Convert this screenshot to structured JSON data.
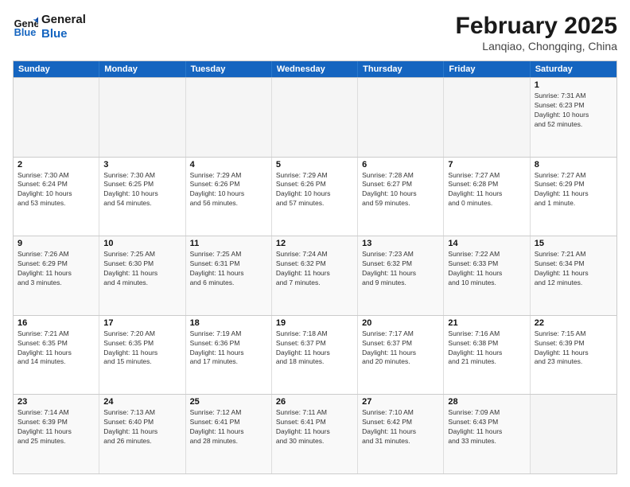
{
  "logo": {
    "line1": "General",
    "line2": "Blue"
  },
  "title": "February 2025",
  "subtitle": "Lanqiao, Chongqing, China",
  "header_days": [
    "Sunday",
    "Monday",
    "Tuesday",
    "Wednesday",
    "Thursday",
    "Friday",
    "Saturday"
  ],
  "weeks": [
    [
      {
        "day": "",
        "info": ""
      },
      {
        "day": "",
        "info": ""
      },
      {
        "day": "",
        "info": ""
      },
      {
        "day": "",
        "info": ""
      },
      {
        "day": "",
        "info": ""
      },
      {
        "day": "",
        "info": ""
      },
      {
        "day": "1",
        "info": "Sunrise: 7:31 AM\nSunset: 6:23 PM\nDaylight: 10 hours\nand 52 minutes."
      }
    ],
    [
      {
        "day": "2",
        "info": "Sunrise: 7:30 AM\nSunset: 6:24 PM\nDaylight: 10 hours\nand 53 minutes."
      },
      {
        "day": "3",
        "info": "Sunrise: 7:30 AM\nSunset: 6:25 PM\nDaylight: 10 hours\nand 54 minutes."
      },
      {
        "day": "4",
        "info": "Sunrise: 7:29 AM\nSunset: 6:26 PM\nDaylight: 10 hours\nand 56 minutes."
      },
      {
        "day": "5",
        "info": "Sunrise: 7:29 AM\nSunset: 6:26 PM\nDaylight: 10 hours\nand 57 minutes."
      },
      {
        "day": "6",
        "info": "Sunrise: 7:28 AM\nSunset: 6:27 PM\nDaylight: 10 hours\nand 59 minutes."
      },
      {
        "day": "7",
        "info": "Sunrise: 7:27 AM\nSunset: 6:28 PM\nDaylight: 11 hours\nand 0 minutes."
      },
      {
        "day": "8",
        "info": "Sunrise: 7:27 AM\nSunset: 6:29 PM\nDaylight: 11 hours\nand 1 minute."
      }
    ],
    [
      {
        "day": "9",
        "info": "Sunrise: 7:26 AM\nSunset: 6:29 PM\nDaylight: 11 hours\nand 3 minutes."
      },
      {
        "day": "10",
        "info": "Sunrise: 7:25 AM\nSunset: 6:30 PM\nDaylight: 11 hours\nand 4 minutes."
      },
      {
        "day": "11",
        "info": "Sunrise: 7:25 AM\nSunset: 6:31 PM\nDaylight: 11 hours\nand 6 minutes."
      },
      {
        "day": "12",
        "info": "Sunrise: 7:24 AM\nSunset: 6:32 PM\nDaylight: 11 hours\nand 7 minutes."
      },
      {
        "day": "13",
        "info": "Sunrise: 7:23 AM\nSunset: 6:32 PM\nDaylight: 11 hours\nand 9 minutes."
      },
      {
        "day": "14",
        "info": "Sunrise: 7:22 AM\nSunset: 6:33 PM\nDaylight: 11 hours\nand 10 minutes."
      },
      {
        "day": "15",
        "info": "Sunrise: 7:21 AM\nSunset: 6:34 PM\nDaylight: 11 hours\nand 12 minutes."
      }
    ],
    [
      {
        "day": "16",
        "info": "Sunrise: 7:21 AM\nSunset: 6:35 PM\nDaylight: 11 hours\nand 14 minutes."
      },
      {
        "day": "17",
        "info": "Sunrise: 7:20 AM\nSunset: 6:35 PM\nDaylight: 11 hours\nand 15 minutes."
      },
      {
        "day": "18",
        "info": "Sunrise: 7:19 AM\nSunset: 6:36 PM\nDaylight: 11 hours\nand 17 minutes."
      },
      {
        "day": "19",
        "info": "Sunrise: 7:18 AM\nSunset: 6:37 PM\nDaylight: 11 hours\nand 18 minutes."
      },
      {
        "day": "20",
        "info": "Sunrise: 7:17 AM\nSunset: 6:37 PM\nDaylight: 11 hours\nand 20 minutes."
      },
      {
        "day": "21",
        "info": "Sunrise: 7:16 AM\nSunset: 6:38 PM\nDaylight: 11 hours\nand 21 minutes."
      },
      {
        "day": "22",
        "info": "Sunrise: 7:15 AM\nSunset: 6:39 PM\nDaylight: 11 hours\nand 23 minutes."
      }
    ],
    [
      {
        "day": "23",
        "info": "Sunrise: 7:14 AM\nSunset: 6:39 PM\nDaylight: 11 hours\nand 25 minutes."
      },
      {
        "day": "24",
        "info": "Sunrise: 7:13 AM\nSunset: 6:40 PM\nDaylight: 11 hours\nand 26 minutes."
      },
      {
        "day": "25",
        "info": "Sunrise: 7:12 AM\nSunset: 6:41 PM\nDaylight: 11 hours\nand 28 minutes."
      },
      {
        "day": "26",
        "info": "Sunrise: 7:11 AM\nSunset: 6:41 PM\nDaylight: 11 hours\nand 30 minutes."
      },
      {
        "day": "27",
        "info": "Sunrise: 7:10 AM\nSunset: 6:42 PM\nDaylight: 11 hours\nand 31 minutes."
      },
      {
        "day": "28",
        "info": "Sunrise: 7:09 AM\nSunset: 6:43 PM\nDaylight: 11 hours\nand 33 minutes."
      },
      {
        "day": "",
        "info": ""
      }
    ]
  ]
}
